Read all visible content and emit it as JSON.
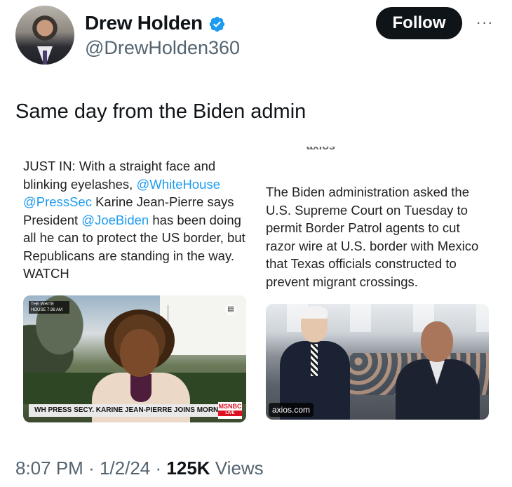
{
  "author": {
    "name": "Drew Holden",
    "handle": "@DrewHolden360",
    "verified_icon": "verified-badge-icon"
  },
  "actions": {
    "follow_label": "Follow",
    "more_label": "···"
  },
  "tweet": {
    "text": "Same day from the Biden admin"
  },
  "left_card": {
    "p1": "JUST IN: With a straight face and blinking eyelashes,",
    "m1": "@WhiteHouse",
    "m2": "@PressSec",
    "p2": "Karine Jean-Pierre says President",
    "m3": "@JoeBiden",
    "p3": "has been doing all he can to protect the US border, but Republicans are standing in the way. WATCH",
    "video": {
      "corner_badge": "THE WHITE HOUSE 7:36 AM",
      "chyron": "WH PRESS SECY. KARINE JEAN-PIERRE JOINS MORNING JOE",
      "network": "MSNBC",
      "live": "LIVE"
    }
  },
  "right_card": {
    "source_fragment": "axios",
    "text": "The Biden administration asked the U.S. Supreme Court on Tuesday to permit Border Patrol agents to cut razor wire at U.S. border with Mexico that Texas officials constructed to prevent migrant crossings.",
    "photo_caption": "axios.com"
  },
  "meta": {
    "time": "8:07 PM",
    "sep1": "·",
    "date": "1/2/24",
    "sep2": "·",
    "views_count": "125K",
    "views_label": "Views"
  },
  "colors": {
    "accent": "#1d9bf0",
    "text": "#0f1419",
    "muted": "#536471",
    "button": "#0f1419"
  }
}
